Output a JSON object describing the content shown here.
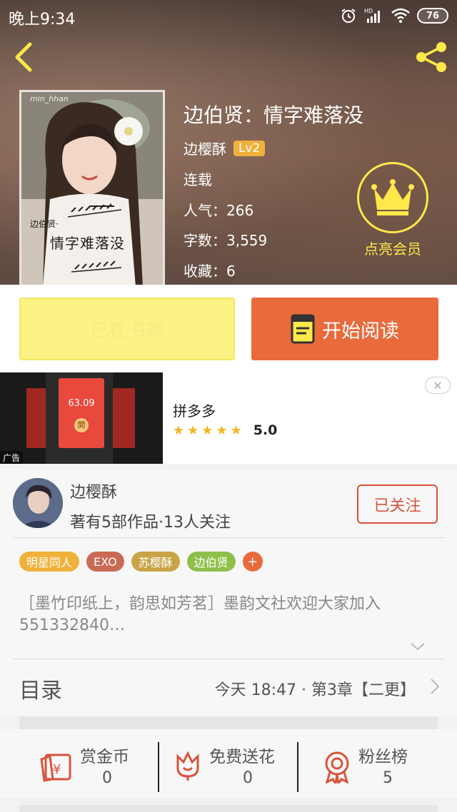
{
  "status_bar": {
    "time": "晚上9:34",
    "battery": "76",
    "hd_label": "HD"
  },
  "book": {
    "title": "边伯贤：情字难落没",
    "author": "边樱酥",
    "level": "Lv2",
    "status": "连载",
    "popularity": "人气：266",
    "word_count": "字数：3,559",
    "favorites": "收藏：6",
    "cover_text": "情字难落没",
    "cover_small_text": "边伯贤·",
    "cover_watermark": "min_hhan"
  },
  "vip": {
    "label": "点亮会员"
  },
  "actions": {
    "shelf_label": "已在书架",
    "read_label": "开始阅读"
  },
  "ad": {
    "title": "拼多多",
    "rating": "5.0",
    "stars": 5,
    "tag": "广告",
    "amount": "63.09",
    "open_label": "開",
    "close_glyph": "✕"
  },
  "author_section": {
    "name": "边樱酥",
    "summary": "著有5部作品·13人关注",
    "follow_label": "已关注",
    "tags": [
      {
        "label": "明星同人",
        "color": "#f0b13a"
      },
      {
        "label": "EXO",
        "color": "#c96a55"
      },
      {
        "label": "苏樱酥",
        "color": "#c9a446"
      },
      {
        "label": "边伯贤",
        "color": "#8fbf4a"
      }
    ],
    "add_tag": "+",
    "description": "［墨竹印纸上，韵思如芳茗］墨韵文社欢迎大家加入551332840…"
  },
  "toc": {
    "label": "目录",
    "latest": "今天 18:47 · 第3章【二更】"
  },
  "stats": {
    "reward": {
      "label": "赏金币",
      "value": "0"
    },
    "flowers": {
      "label": "免费送花",
      "value": "0"
    },
    "fans": {
      "label": "粉丝榜",
      "value": "5"
    }
  },
  "colors": {
    "accent": "#e96a3b",
    "vip_yellow": "#ffe84a",
    "shelf_yellow": "#fbf383"
  }
}
